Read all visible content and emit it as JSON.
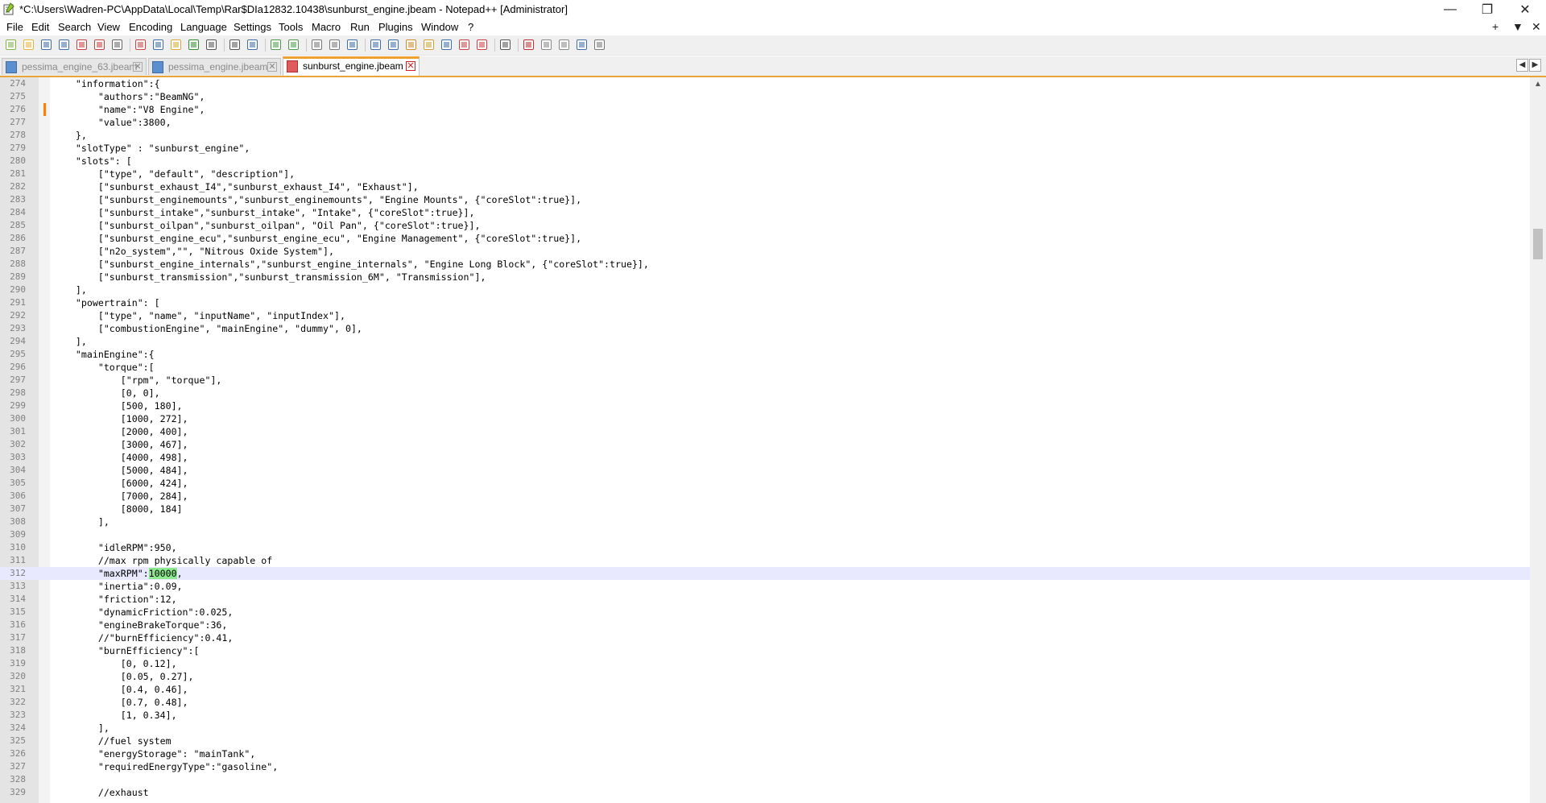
{
  "window": {
    "title": "*C:\\Users\\Wadren-PC\\AppData\\Local\\Temp\\Rar$DIa12832.10438\\sunburst_engine.jbeam - Notepad++ [Administrator]",
    "minimize_glyph": "—",
    "maximize_glyph": "❐",
    "close_glyph": "✕"
  },
  "menu": {
    "items": [
      "File",
      "Edit",
      "Search",
      "View",
      "Encoding",
      "Language",
      "Settings",
      "Tools",
      "Macro",
      "Run",
      "Plugins",
      "Window",
      "?"
    ],
    "right_glyphs": [
      "+",
      "▼",
      "✕"
    ]
  },
  "toolbar": {
    "icons": [
      "new-file-icon",
      "open-file-icon",
      "save-icon",
      "save-all-icon",
      "close-icon",
      "close-all-icon",
      "print-icon",
      "cut-icon",
      "copy-icon",
      "paste-icon",
      "undo-icon",
      "redo-icon",
      "find-icon",
      "replace-icon",
      "zoom-in-icon",
      "zoom-out-icon",
      "sync-vertical-icon",
      "sync-horizontal-icon",
      "word-wrap-icon",
      "show-all-chars-icon",
      "indent-guide-icon",
      "lang-udl-icon",
      "doc-map-icon",
      "function-list-icon",
      "folder-workspace-icon",
      "monitoring-icon",
      "show-icon",
      "record-macro-icon",
      "stop-macro-icon",
      "play-macro-icon",
      "run-macro-multiple-icon",
      "save-macro-icon"
    ]
  },
  "tabs": [
    {
      "label": "pessima_engine_63.jbeam",
      "active": false,
      "close_glyph": "✕"
    },
    {
      "label": "pessima_engine.jbeam",
      "active": false,
      "close_glyph": "✕"
    },
    {
      "label": "sunburst_engine.jbeam",
      "active": true,
      "close_glyph": "✕"
    }
  ],
  "tab_scroll": {
    "left": "◀",
    "right": "▶"
  },
  "editor": {
    "current_line": 312,
    "highlight_token": "10000",
    "changed_lines": [
      276
    ],
    "lines": [
      {
        "n": "274",
        "text": "    \"information\":{"
      },
      {
        "n": "275",
        "text": "        \"authors\":\"BeamNG\","
      },
      {
        "n": "276",
        "text": "        \"name\":\"V8 Engine\","
      },
      {
        "n": "277",
        "text": "        \"value\":3800,"
      },
      {
        "n": "278",
        "text": "    },"
      },
      {
        "n": "279",
        "text": "    \"slotType\" : \"sunburst_engine\","
      },
      {
        "n": "280",
        "text": "    \"slots\": ["
      },
      {
        "n": "281",
        "text": "        [\"type\", \"default\", \"description\"],"
      },
      {
        "n": "282",
        "text": "        [\"sunburst_exhaust_I4\",\"sunburst_exhaust_I4\", \"Exhaust\"],"
      },
      {
        "n": "283",
        "text": "        [\"sunburst_enginemounts\",\"sunburst_enginemounts\", \"Engine Mounts\", {\"coreSlot\":true}],"
      },
      {
        "n": "284",
        "text": "        [\"sunburst_intake\",\"sunburst_intake\", \"Intake\", {\"coreSlot\":true}],"
      },
      {
        "n": "285",
        "text": "        [\"sunburst_oilpan\",\"sunburst_oilpan\", \"Oil Pan\", {\"coreSlot\":true}],"
      },
      {
        "n": "286",
        "text": "        [\"sunburst_engine_ecu\",\"sunburst_engine_ecu\", \"Engine Management\", {\"coreSlot\":true}],"
      },
      {
        "n": "287",
        "text": "        [\"n2o_system\",\"\", \"Nitrous Oxide System\"],"
      },
      {
        "n": "288",
        "text": "        [\"sunburst_engine_internals\",\"sunburst_engine_internals\", \"Engine Long Block\", {\"coreSlot\":true}],"
      },
      {
        "n": "289",
        "text": "        [\"sunburst_transmission\",\"sunburst_transmission_6M\", \"Transmission\"],"
      },
      {
        "n": "290",
        "text": "    ],"
      },
      {
        "n": "291",
        "text": "    \"powertrain\": ["
      },
      {
        "n": "292",
        "text": "        [\"type\", \"name\", \"inputName\", \"inputIndex\"],"
      },
      {
        "n": "293",
        "text": "        [\"combustionEngine\", \"mainEngine\", \"dummy\", 0],"
      },
      {
        "n": "294",
        "text": "    ],"
      },
      {
        "n": "295",
        "text": "    \"mainEngine\":{"
      },
      {
        "n": "296",
        "text": "        \"torque\":["
      },
      {
        "n": "297",
        "text": "            [\"rpm\", \"torque\"],"
      },
      {
        "n": "298",
        "text": "            [0, 0],"
      },
      {
        "n": "299",
        "text": "            [500, 180],"
      },
      {
        "n": "300",
        "text": "            [1000, 272],"
      },
      {
        "n": "301",
        "text": "            [2000, 400],"
      },
      {
        "n": "302",
        "text": "            [3000, 467],"
      },
      {
        "n": "303",
        "text": "            [4000, 498],"
      },
      {
        "n": "304",
        "text": "            [5000, 484],"
      },
      {
        "n": "305",
        "text": "            [6000, 424],"
      },
      {
        "n": "306",
        "text": "            [7000, 284],"
      },
      {
        "n": "307",
        "text": "            [8000, 184]"
      },
      {
        "n": "308",
        "text": "        ],"
      },
      {
        "n": "309",
        "text": ""
      },
      {
        "n": "310",
        "text": "        \"idleRPM\":950,"
      },
      {
        "n": "311",
        "text": "        //max rpm physically capable of"
      },
      {
        "n": "312",
        "text": "        \"maxRPM\":10000,"
      },
      {
        "n": "313",
        "text": "        \"inertia\":0.09,"
      },
      {
        "n": "314",
        "text": "        \"friction\":12,"
      },
      {
        "n": "315",
        "text": "        \"dynamicFriction\":0.025,"
      },
      {
        "n": "316",
        "text": "        \"engineBrakeTorque\":36,"
      },
      {
        "n": "317",
        "text": "        //\"burnEfficiency\":0.41,"
      },
      {
        "n": "318",
        "text": "        \"burnEfficiency\":["
      },
      {
        "n": "319",
        "text": "            [0, 0.12],"
      },
      {
        "n": "320",
        "text": "            [0.05, 0.27],"
      },
      {
        "n": "321",
        "text": "            [0.4, 0.46],"
      },
      {
        "n": "322",
        "text": "            [0.7, 0.48],"
      },
      {
        "n": "323",
        "text": "            [1, 0.34],"
      },
      {
        "n": "324",
        "text": "        ],"
      },
      {
        "n": "325",
        "text": "        //fuel system"
      },
      {
        "n": "326",
        "text": "        \"energyStorage\": \"mainTank\","
      },
      {
        "n": "327",
        "text": "        \"requiredEnergyType\":\"gasoline\","
      },
      {
        "n": "328",
        "text": ""
      },
      {
        "n": "329",
        "text": "        //exhaust"
      }
    ]
  },
  "scrollbar": {
    "up": "▲"
  }
}
